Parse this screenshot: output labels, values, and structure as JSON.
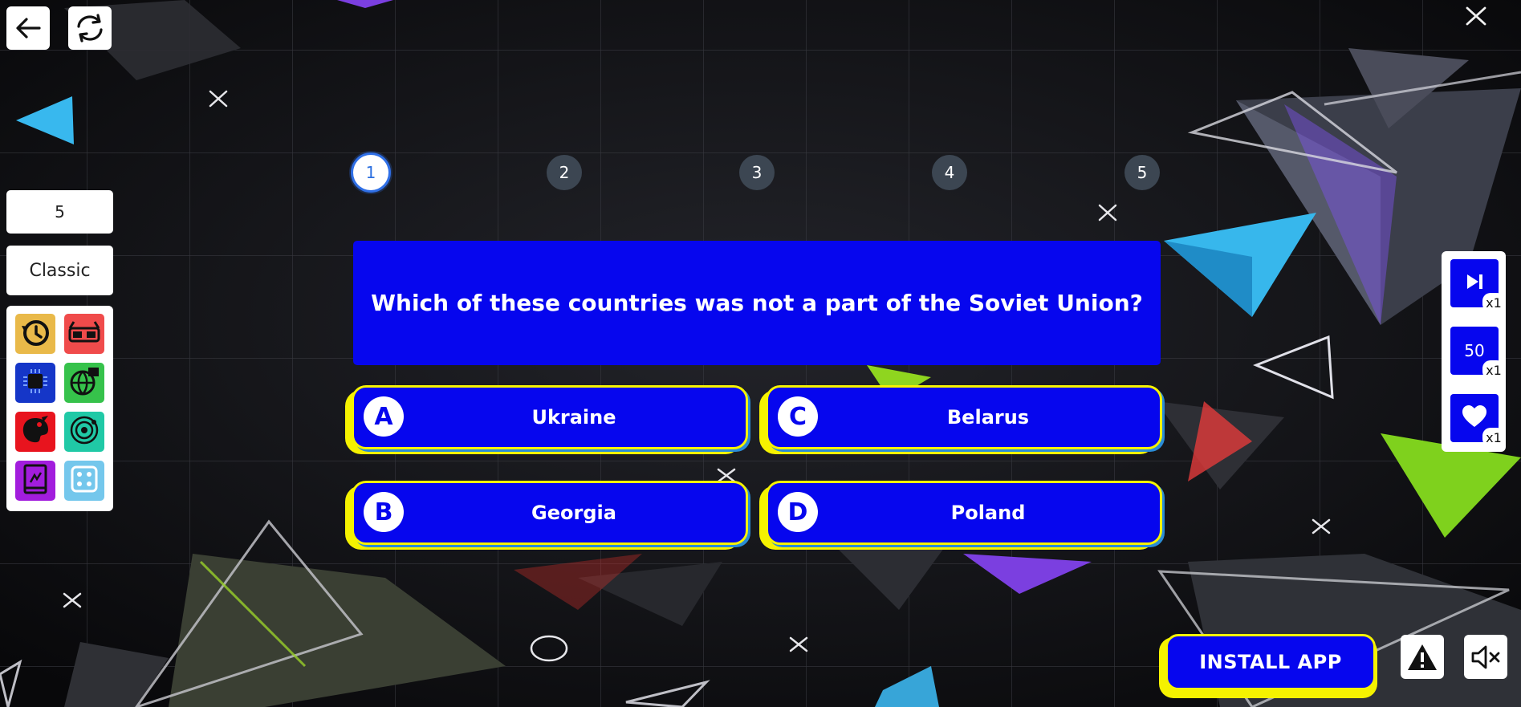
{
  "toolbar": {
    "back_icon": "arrow-left-icon",
    "refresh_icon": "refresh-icon",
    "close_icon": "close-x-icon"
  },
  "settings": {
    "question_count": "5",
    "mode": "Classic"
  },
  "categories": [
    {
      "icon": "history-clock-icon",
      "color": "#e9b949"
    },
    {
      "icon": "3d-glasses-icon",
      "color": "#f04b4b"
    },
    {
      "icon": "microchip-icon",
      "color": "#1536c8"
    },
    {
      "icon": "globe-map-icon",
      "color": "#36c24b"
    },
    {
      "icon": "palette-icon",
      "color": "#e8141e"
    },
    {
      "icon": "atom-orbit-icon",
      "color": "#20c9a6"
    },
    {
      "icon": "book-icon",
      "color": "#a21ddd"
    },
    {
      "icon": "dice-icon",
      "color": "#74c7ec"
    }
  ],
  "progress": {
    "steps": [
      "1",
      "2",
      "3",
      "4",
      "5"
    ],
    "current": 1
  },
  "question": {
    "text": "Which of these countries was not a part of the Soviet Union?"
  },
  "answers": [
    {
      "letter": "A",
      "text": "Ukraine"
    },
    {
      "letter": "B",
      "text": "Georgia"
    },
    {
      "letter": "C",
      "text": "Belarus"
    },
    {
      "letter": "D",
      "text": "Poland"
    }
  ],
  "powerups": [
    {
      "icon": "skip-icon",
      "label": "",
      "count": "x1"
    },
    {
      "icon": "fifty-fifty",
      "label": "50",
      "count": "x1"
    },
    {
      "icon": "heart-icon",
      "label": "",
      "count": "x1"
    }
  ],
  "footer": {
    "install_label": "INSTALL APP",
    "report_icon": "warning-icon",
    "mute_icon": "speaker-muted-icon"
  },
  "colors": {
    "accent_blue": "#0606ee",
    "accent_yellow": "#f5f200"
  }
}
